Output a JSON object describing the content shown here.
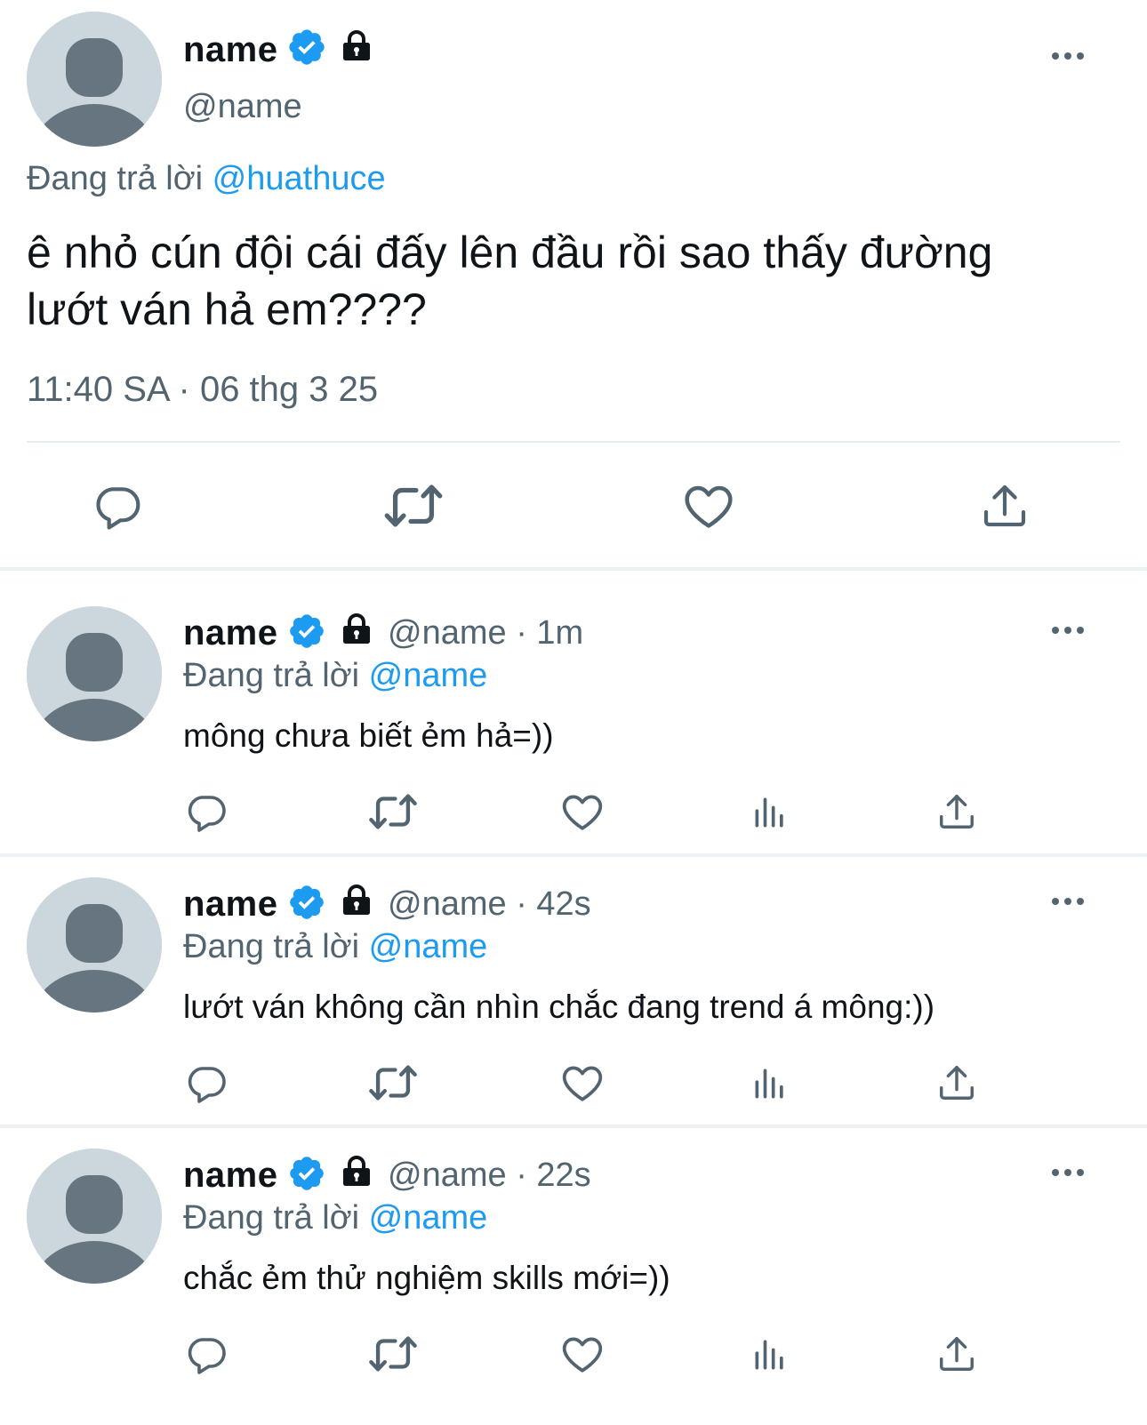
{
  "main_tweet": {
    "name": "name",
    "handle": "@name",
    "replying_prefix": "Đang trả lời",
    "replying_to": "@huathuce",
    "text_line1": "ê nhỏ cún đội cái đấy lên đầu rồi sao thấy đường",
    "text_line2": "lướt ván hả em????",
    "timestamp": "11:40 SA · 06 thg 3 25",
    "icons": [
      "verified-badge-icon",
      "lock-icon",
      "more-icon",
      "reply-icon",
      "retweet-icon",
      "like-icon",
      "share-icon"
    ]
  },
  "replies": [
    {
      "name": "name",
      "handle_time": "@name · 1m",
      "replying_prefix": "Đang trả lời",
      "replying_to": "@name",
      "text": "mông chưa biết ẻm hả=))"
    },
    {
      "name": "name",
      "handle_time": "@name · 42s",
      "replying_prefix": "Đang trả lời",
      "replying_to": "@name",
      "text": "lướt ván không cần nhìn chắc đang trend á mông:))"
    },
    {
      "name": "name",
      "handle_time": "@name · 22s",
      "replying_prefix": "Đang trả lời",
      "replying_to": "@name",
      "text": "chắc ẻm thử nghiệm skills mới=))"
    }
  ],
  "colors": {
    "link": "#1d9bf0",
    "muted": "#536471",
    "text": "#0f1419",
    "avatar_bg": "#ccd6dd",
    "avatar_fg": "#66757f"
  }
}
